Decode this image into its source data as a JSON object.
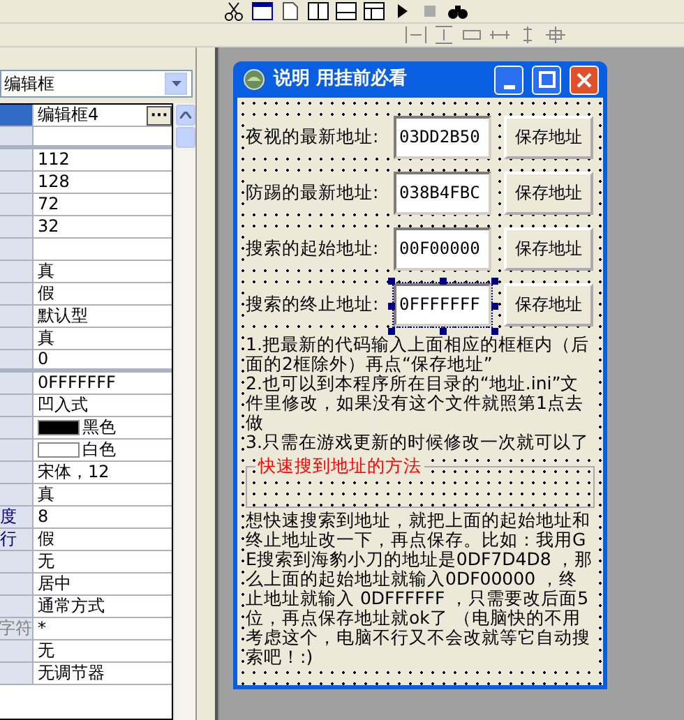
{
  "object_selector": {
    "value": "编辑框"
  },
  "properties": [
    {
      "value": "编辑框4",
      "kind": "text",
      "selected": true,
      "ellipsis_button": "···"
    },
    {
      "kind": "blank",
      "selected": false,
      "section_break": true
    },
    {
      "value": "112",
      "kind": "text",
      "selected": false
    },
    {
      "value": "128",
      "kind": "text",
      "selected": false
    },
    {
      "value": "72",
      "kind": "text",
      "selected": false
    },
    {
      "value": "32",
      "kind": "text",
      "selected": false
    },
    {
      "kind": "blank",
      "selected": false
    },
    {
      "value": "真",
      "kind": "text",
      "selected": false
    },
    {
      "value": "假",
      "kind": "text",
      "selected": false
    },
    {
      "value": "默认型",
      "kind": "text",
      "selected": false
    },
    {
      "value": "真",
      "kind": "text",
      "selected": false
    },
    {
      "value": "0",
      "kind": "text",
      "selected": false,
      "section_break": true
    },
    {
      "value": "0FFFFFFF",
      "kind": "text",
      "selected": false
    },
    {
      "value": "凹入式",
      "kind": "text",
      "selected": false
    },
    {
      "value": "黑色",
      "kind": "swatch",
      "color": "#000000",
      "selected": false
    },
    {
      "value": "白色",
      "kind": "swatch",
      "color": "#ffffff",
      "selected": false
    },
    {
      "value": "宋体，12",
      "kind": "text",
      "selected": false
    },
    {
      "value": "真",
      "kind": "text",
      "selected": false
    },
    {
      "label": "度",
      "label_emphasis": true,
      "value": "8",
      "kind": "text",
      "selected": false
    },
    {
      "label": "行",
      "label_emphasis": true,
      "value": "假",
      "kind": "text",
      "selected": false
    },
    {
      "value": "无",
      "kind": "text",
      "selected": false
    },
    {
      "value": "居中",
      "kind": "text",
      "selected": false
    },
    {
      "value": "通常方式",
      "kind": "text",
      "selected": false
    },
    {
      "label": "字符",
      "label_disabled": true,
      "value": "*",
      "kind": "text",
      "selected": false
    },
    {
      "value": "无",
      "kind": "text",
      "selected": false
    },
    {
      "value": "无调节器",
      "kind": "text",
      "selected": false
    }
  ],
  "form": {
    "title": "说明  用挂前必看",
    "fields": [
      {
        "label": "夜视的最新地址:",
        "value": "03DD2B50",
        "button": "保存地址",
        "selected": false
      },
      {
        "label": "防踢的最新地址:",
        "value": "038B4FBC",
        "button": "保存地址",
        "selected": false
      },
      {
        "label": "搜索的起始地址:",
        "value": "00F00000",
        "button": "保存地址",
        "selected": false
      },
      {
        "label": "搜索的终止地址:",
        "value": "0FFFFFFF",
        "button": "保存地址",
        "selected": true
      }
    ],
    "notes": [
      "1.把最新的代码输入上面相应的框框内（后面的2框除外）再点“保存地址”",
      "2.也可以到本程序所在目录的“地址.ini”文件里修改，如果没有这个文件就照第1点去做",
      "3.只需在游戏更新的时候修改一次就可以了"
    ],
    "group": {
      "title": "快速搜到地址的方法"
    },
    "method_text": "想快速搜索到地址，就把上面的起始地址和终止地址改一下，再点保存。比如：我用GE搜索到海豹小刀的地址是0DF7D4D8 ，那么上面的起始地址就输入0DF00000 ，终止地址就输入 0DFFFFFF ，只需要改后面5位，再点保存地址就ok了 （电脑快的不用考虑这个，电脑不行又不会改就等它自动搜索吧！:)"
  }
}
